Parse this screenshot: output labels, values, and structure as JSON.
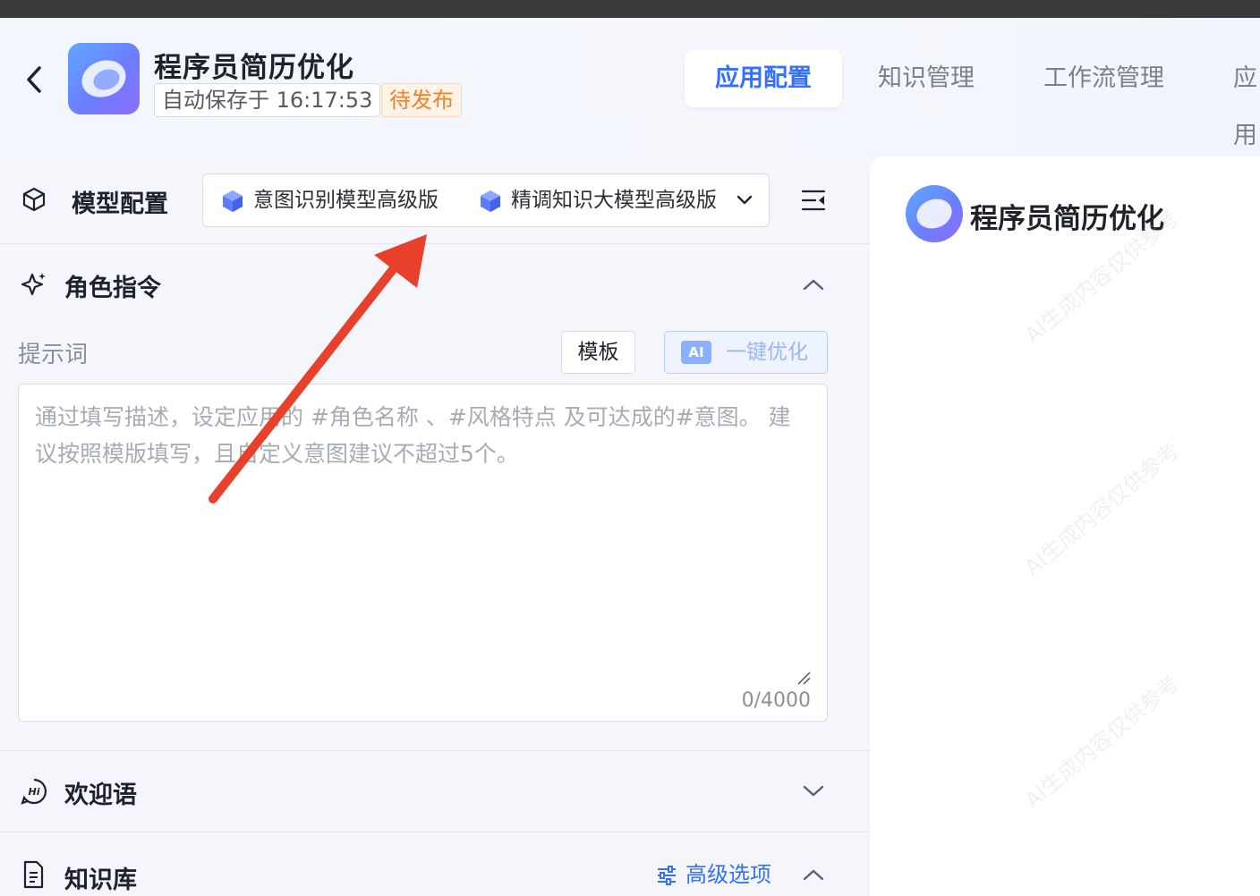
{
  "header": {
    "app_title": "程序员简历优化",
    "autosave": "自动保存于 16:17:53",
    "status": "待发布",
    "tabs": [
      {
        "label": "应用配置"
      },
      {
        "label": "知识管理"
      },
      {
        "label": "工作流管理"
      },
      {
        "label": "应用"
      }
    ]
  },
  "model_config": {
    "title": "模型配置",
    "models": [
      {
        "label": "意图识别模型高级版"
      },
      {
        "label": "精调知识大模型高级版"
      }
    ]
  },
  "role_instruction": {
    "title": "角色指令",
    "prompt_label": "提示词",
    "template_button": "模板",
    "ai_badge": "AI",
    "ai_optimize_button": "一键优化",
    "placeholder": "通过填写描述，设定应用的 #角色名称 、#风格特点 及可达成的#意图。 建议按照模版填写，且自定义意图建议不超过5个。",
    "counter": "0/4000"
  },
  "welcome": {
    "title": "欢迎语"
  },
  "knowledge": {
    "title": "知识库",
    "advanced_options": "高级选项"
  },
  "preview": {
    "title": "程序员简历优化",
    "watermark": "AI生成内容仅供参考"
  },
  "colors": {
    "accent": "#3370ff",
    "status_orange": "#f0802a",
    "annotation_arrow": "#e8402a"
  }
}
